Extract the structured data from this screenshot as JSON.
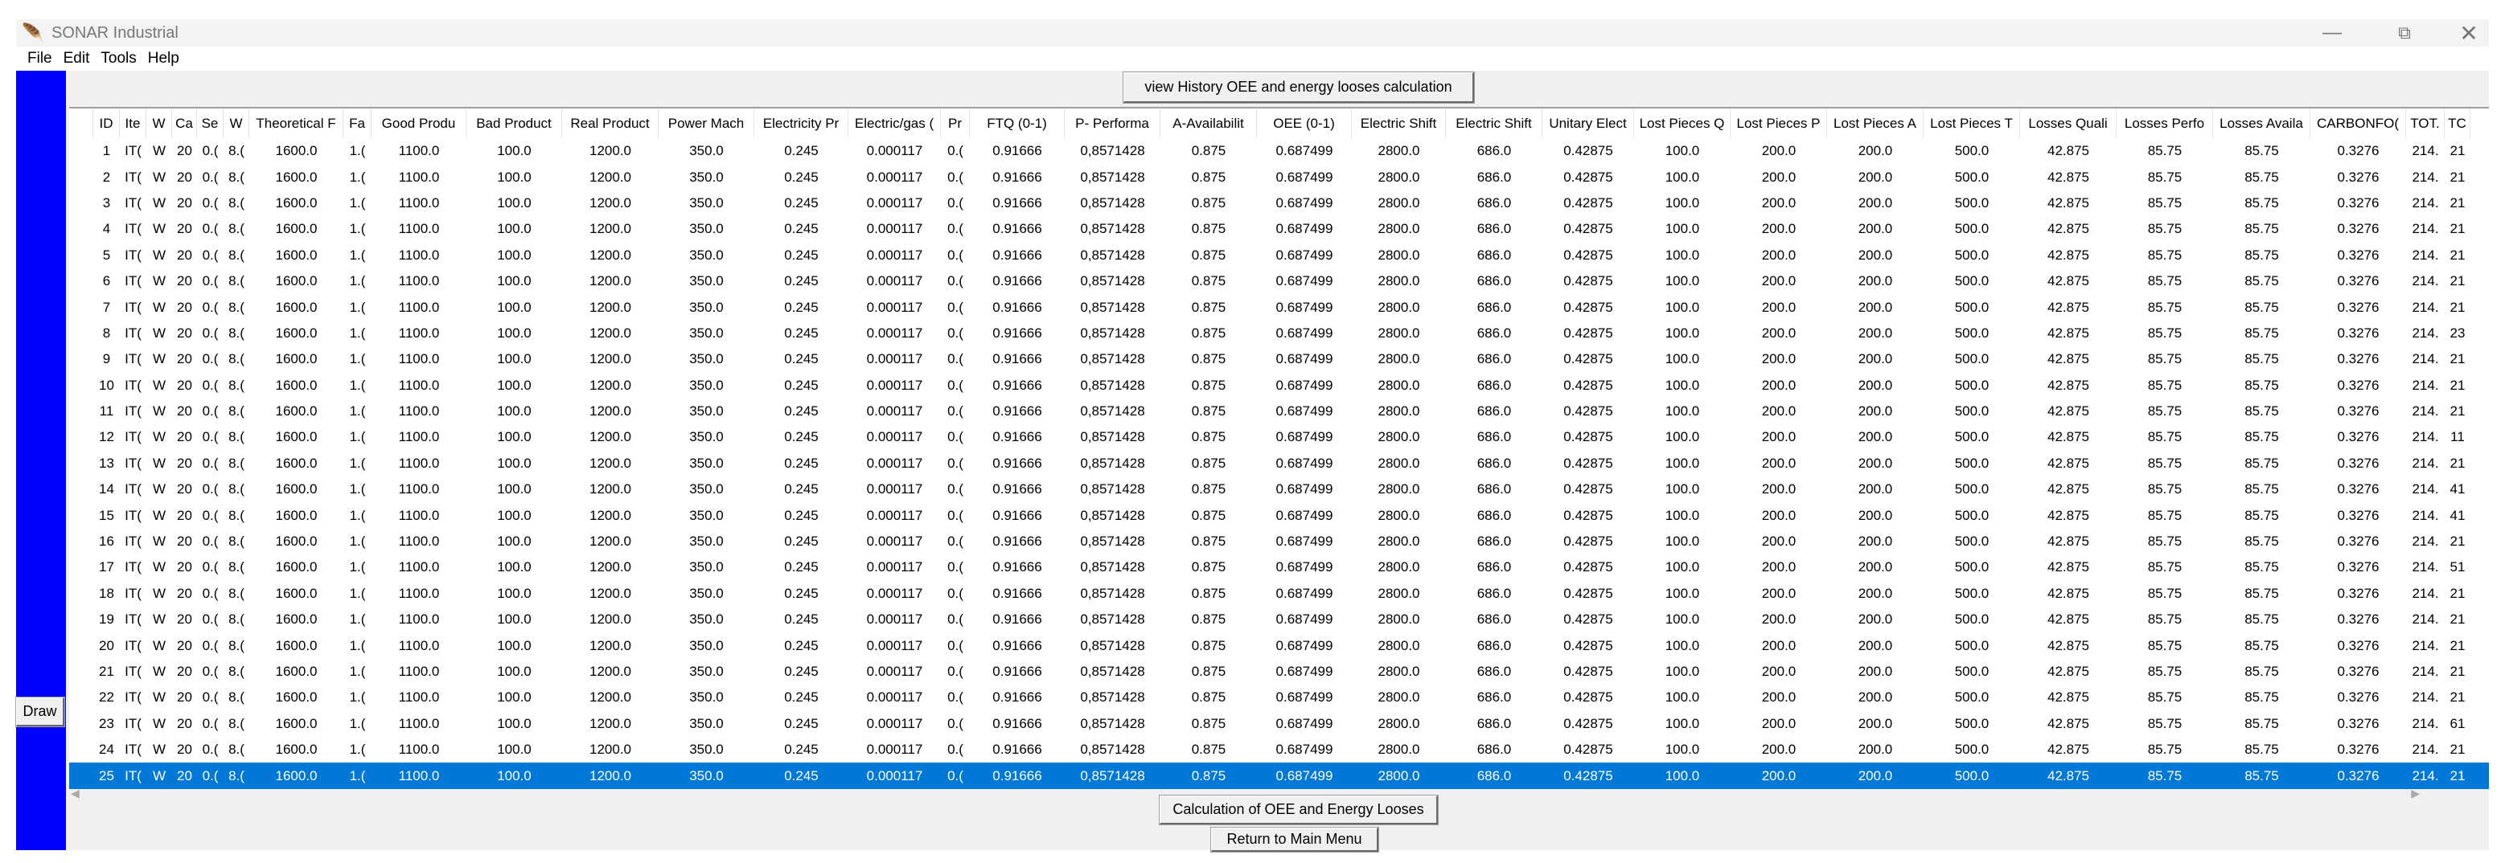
{
  "window": {
    "title": "SONAR Industrial",
    "icon": "feather-icon",
    "controls": [
      "minimize",
      "restore",
      "close"
    ]
  },
  "menu": [
    "File",
    "Edit",
    "Tools",
    "Help"
  ],
  "buttons": {
    "history": "view History OEE and energy looses calculation",
    "calc": "Calculation of OEE and Energy Looses",
    "return": "Return to Main Menu",
    "draw": "Draw"
  },
  "colors": {
    "sidebar": "#0000ff",
    "selection": "#0078d7"
  },
  "table": {
    "headers": [
      "",
      "ID",
      "Ite",
      "W",
      "Ca",
      "Se",
      "W",
      "Theoretical F",
      "Fa",
      "Good Produ",
      "Bad Product",
      "Real Product",
      "Power Mach",
      "Electricity Pr",
      "Electric/gas (",
      "Pr",
      "FTQ (0-1)",
      "P- Performa",
      "A-Availabilit",
      "OEE (0-1)",
      "Electric Shift",
      "Electric Shift",
      "Unitary Elect",
      "Lost Pieces Q",
      "Lost Pieces P",
      "Lost Pieces A",
      "Lost Pieces T",
      "Losses Quali",
      "Losses Perfo",
      "Losses Availa",
      "CARBONFO(",
      "TOT.",
      "TC"
    ],
    "selected_row": 25,
    "rows": [
      [
        "",
        "1",
        "IT(",
        "W",
        "20",
        "0.(",
        "8.(",
        "1600.0",
        "1.(",
        "1100.0",
        "100.0",
        "1200.0",
        "350.0",
        "0.245",
        "0.000117",
        "0.(",
        "0.91666",
        "0,8571428",
        "0.875",
        "0.687499",
        "2800.0",
        "686.0",
        "0.42875",
        "100.0",
        "200.0",
        "200.0",
        "500.0",
        "42.875",
        "85.75",
        "85.75",
        "0.3276",
        "214.",
        "21"
      ],
      [
        "",
        "2",
        "IT(",
        "W",
        "20",
        "0.(",
        "8.(",
        "1600.0",
        "1.(",
        "1100.0",
        "100.0",
        "1200.0",
        "350.0",
        "0.245",
        "0.000117",
        "0.(",
        "0.91666",
        "0,8571428",
        "0.875",
        "0.687499",
        "2800.0",
        "686.0",
        "0.42875",
        "100.0",
        "200.0",
        "200.0",
        "500.0",
        "42.875",
        "85.75",
        "85.75",
        "0.3276",
        "214.",
        "21"
      ],
      [
        "",
        "3",
        "IT(",
        "W",
        "20",
        "0.(",
        "8.(",
        "1600.0",
        "1.(",
        "1100.0",
        "100.0",
        "1200.0",
        "350.0",
        "0.245",
        "0.000117",
        "0.(",
        "0.91666",
        "0,8571428",
        "0.875",
        "0.687499",
        "2800.0",
        "686.0",
        "0.42875",
        "100.0",
        "200.0",
        "200.0",
        "500.0",
        "42.875",
        "85.75",
        "85.75",
        "0.3276",
        "214.",
        "21"
      ],
      [
        "",
        "4",
        "IT(",
        "W",
        "20",
        "0.(",
        "8.(",
        "1600.0",
        "1.(",
        "1100.0",
        "100.0",
        "1200.0",
        "350.0",
        "0.245",
        "0.000117",
        "0.(",
        "0.91666",
        "0,8571428",
        "0.875",
        "0.687499",
        "2800.0",
        "686.0",
        "0.42875",
        "100.0",
        "200.0",
        "200.0",
        "500.0",
        "42.875",
        "85.75",
        "85.75",
        "0.3276",
        "214.",
        "21"
      ],
      [
        "",
        "5",
        "IT(",
        "W",
        "20",
        "0.(",
        "8.(",
        "1600.0",
        "1.(",
        "1100.0",
        "100.0",
        "1200.0",
        "350.0",
        "0.245",
        "0.000117",
        "0.(",
        "0.91666",
        "0,8571428",
        "0.875",
        "0.687499",
        "2800.0",
        "686.0",
        "0.42875",
        "100.0",
        "200.0",
        "200.0",
        "500.0",
        "42.875",
        "85.75",
        "85.75",
        "0.3276",
        "214.",
        "21"
      ],
      [
        "",
        "6",
        "IT(",
        "W",
        "20",
        "0.(",
        "8.(",
        "1600.0",
        "1.(",
        "1100.0",
        "100.0",
        "1200.0",
        "350.0",
        "0.245",
        "0.000117",
        "0.(",
        "0.91666",
        "0,8571428",
        "0.875",
        "0.687499",
        "2800.0",
        "686.0",
        "0.42875",
        "100.0",
        "200.0",
        "200.0",
        "500.0",
        "42.875",
        "85.75",
        "85.75",
        "0.3276",
        "214.",
        "21"
      ],
      [
        "",
        "7",
        "IT(",
        "W",
        "20",
        "0.(",
        "8.(",
        "1600.0",
        "1.(",
        "1100.0",
        "100.0",
        "1200.0",
        "350.0",
        "0.245",
        "0.000117",
        "0.(",
        "0.91666",
        "0,8571428",
        "0.875",
        "0.687499",
        "2800.0",
        "686.0",
        "0.42875",
        "100.0",
        "200.0",
        "200.0",
        "500.0",
        "42.875",
        "85.75",
        "85.75",
        "0.3276",
        "214.",
        "21"
      ],
      [
        "",
        "8",
        "IT(",
        "W",
        "20",
        "0.(",
        "8.(",
        "1600.0",
        "1.(",
        "1100.0",
        "100.0",
        "1200.0",
        "350.0",
        "0.245",
        "0.000117",
        "0.(",
        "0.91666",
        "0,8571428",
        "0.875",
        "0.687499",
        "2800.0",
        "686.0",
        "0.42875",
        "100.0",
        "200.0",
        "200.0",
        "500.0",
        "42.875",
        "85.75",
        "85.75",
        "0.3276",
        "214.",
        "23"
      ],
      [
        "",
        "9",
        "IT(",
        "W",
        "20",
        "0.(",
        "8.(",
        "1600.0",
        "1.(",
        "1100.0",
        "100.0",
        "1200.0",
        "350.0",
        "0.245",
        "0.000117",
        "0.(",
        "0.91666",
        "0,8571428",
        "0.875",
        "0.687499",
        "2800.0",
        "686.0",
        "0.42875",
        "100.0",
        "200.0",
        "200.0",
        "500.0",
        "42.875",
        "85.75",
        "85.75",
        "0.3276",
        "214.",
        "21"
      ],
      [
        "",
        "10",
        "IT(",
        "W",
        "20",
        "0.(",
        "8.(",
        "1600.0",
        "1.(",
        "1100.0",
        "100.0",
        "1200.0",
        "350.0",
        "0.245",
        "0.000117",
        "0.(",
        "0.91666",
        "0,8571428",
        "0.875",
        "0.687499",
        "2800.0",
        "686.0",
        "0.42875",
        "100.0",
        "200.0",
        "200.0",
        "500.0",
        "42.875",
        "85.75",
        "85.75",
        "0.3276",
        "214.",
        "21"
      ],
      [
        "",
        "11",
        "IT(",
        "W",
        "20",
        "0.(",
        "8.(",
        "1600.0",
        "1.(",
        "1100.0",
        "100.0",
        "1200.0",
        "350.0",
        "0.245",
        "0.000117",
        "0.(",
        "0.91666",
        "0,8571428",
        "0.875",
        "0.687499",
        "2800.0",
        "686.0",
        "0.42875",
        "100.0",
        "200.0",
        "200.0",
        "500.0",
        "42.875",
        "85.75",
        "85.75",
        "0.3276",
        "214.",
        "21"
      ],
      [
        "",
        "12",
        "IT(",
        "W",
        "20",
        "0.(",
        "8.(",
        "1600.0",
        "1.(",
        "1100.0",
        "100.0",
        "1200.0",
        "350.0",
        "0.245",
        "0.000117",
        "0.(",
        "0.91666",
        "0,8571428",
        "0.875",
        "0.687499",
        "2800.0",
        "686.0",
        "0.42875",
        "100.0",
        "200.0",
        "200.0",
        "500.0",
        "42.875",
        "85.75",
        "85.75",
        "0.3276",
        "214.",
        "11"
      ],
      [
        "",
        "13",
        "IT(",
        "W",
        "20",
        "0.(",
        "8.(",
        "1600.0",
        "1.(",
        "1100.0",
        "100.0",
        "1200.0",
        "350.0",
        "0.245",
        "0.000117",
        "0.(",
        "0.91666",
        "0,8571428",
        "0.875",
        "0.687499",
        "2800.0",
        "686.0",
        "0.42875",
        "100.0",
        "200.0",
        "200.0",
        "500.0",
        "42.875",
        "85.75",
        "85.75",
        "0.3276",
        "214.",
        "21"
      ],
      [
        "",
        "14",
        "IT(",
        "W",
        "20",
        "0.(",
        "8.(",
        "1600.0",
        "1.(",
        "1100.0",
        "100.0",
        "1200.0",
        "350.0",
        "0.245",
        "0.000117",
        "0.(",
        "0.91666",
        "0,8571428",
        "0.875",
        "0.687499",
        "2800.0",
        "686.0",
        "0.42875",
        "100.0",
        "200.0",
        "200.0",
        "500.0",
        "42.875",
        "85.75",
        "85.75",
        "0.3276",
        "214.",
        "41"
      ],
      [
        "",
        "15",
        "IT(",
        "W",
        "20",
        "0.(",
        "8.(",
        "1600.0",
        "1.(",
        "1100.0",
        "100.0",
        "1200.0",
        "350.0",
        "0.245",
        "0.000117",
        "0.(",
        "0.91666",
        "0,8571428",
        "0.875",
        "0.687499",
        "2800.0",
        "686.0",
        "0.42875",
        "100.0",
        "200.0",
        "200.0",
        "500.0",
        "42.875",
        "85.75",
        "85.75",
        "0.3276",
        "214.",
        "41"
      ],
      [
        "",
        "16",
        "IT(",
        "W",
        "20",
        "0.(",
        "8.(",
        "1600.0",
        "1.(",
        "1100.0",
        "100.0",
        "1200.0",
        "350.0",
        "0.245",
        "0.000117",
        "0.(",
        "0.91666",
        "0,8571428",
        "0.875",
        "0.687499",
        "2800.0",
        "686.0",
        "0.42875",
        "100.0",
        "200.0",
        "200.0",
        "500.0",
        "42.875",
        "85.75",
        "85.75",
        "0.3276",
        "214.",
        "21"
      ],
      [
        "",
        "17",
        "IT(",
        "W",
        "20",
        "0.(",
        "8.(",
        "1600.0",
        "1.(",
        "1100.0",
        "100.0",
        "1200.0",
        "350.0",
        "0.245",
        "0.000117",
        "0.(",
        "0.91666",
        "0,8571428",
        "0.875",
        "0.687499",
        "2800.0",
        "686.0",
        "0.42875",
        "100.0",
        "200.0",
        "200.0",
        "500.0",
        "42.875",
        "85.75",
        "85.75",
        "0.3276",
        "214.",
        "51"
      ],
      [
        "",
        "18",
        "IT(",
        "W",
        "20",
        "0.(",
        "8.(",
        "1600.0",
        "1.(",
        "1100.0",
        "100.0",
        "1200.0",
        "350.0",
        "0.245",
        "0.000117",
        "0.(",
        "0.91666",
        "0,8571428",
        "0.875",
        "0.687499",
        "2800.0",
        "686.0",
        "0.42875",
        "100.0",
        "200.0",
        "200.0",
        "500.0",
        "42.875",
        "85.75",
        "85.75",
        "0.3276",
        "214.",
        "21"
      ],
      [
        "",
        "19",
        "IT(",
        "W",
        "20",
        "0.(",
        "8.(",
        "1600.0",
        "1.(",
        "1100.0",
        "100.0",
        "1200.0",
        "350.0",
        "0.245",
        "0.000117",
        "0.(",
        "0.91666",
        "0,8571428",
        "0.875",
        "0.687499",
        "2800.0",
        "686.0",
        "0.42875",
        "100.0",
        "200.0",
        "200.0",
        "500.0",
        "42.875",
        "85.75",
        "85.75",
        "0.3276",
        "214.",
        "21"
      ],
      [
        "",
        "20",
        "IT(",
        "W",
        "20",
        "0.(",
        "8.(",
        "1600.0",
        "1.(",
        "1100.0",
        "100.0",
        "1200.0",
        "350.0",
        "0.245",
        "0.000117",
        "0.(",
        "0.91666",
        "0,8571428",
        "0.875",
        "0.687499",
        "2800.0",
        "686.0",
        "0.42875",
        "100.0",
        "200.0",
        "200.0",
        "500.0",
        "42.875",
        "85.75",
        "85.75",
        "0.3276",
        "214.",
        "21"
      ],
      [
        "",
        "21",
        "IT(",
        "W",
        "20",
        "0.(",
        "8.(",
        "1600.0",
        "1.(",
        "1100.0",
        "100.0",
        "1200.0",
        "350.0",
        "0.245",
        "0.000117",
        "0.(",
        "0.91666",
        "0,8571428",
        "0.875",
        "0.687499",
        "2800.0",
        "686.0",
        "0.42875",
        "100.0",
        "200.0",
        "200.0",
        "500.0",
        "42.875",
        "85.75",
        "85.75",
        "0.3276",
        "214.",
        "21"
      ],
      [
        "",
        "22",
        "IT(",
        "W",
        "20",
        "0.(",
        "8.(",
        "1600.0",
        "1.(",
        "1100.0",
        "100.0",
        "1200.0",
        "350.0",
        "0.245",
        "0.000117",
        "0.(",
        "0.91666",
        "0,8571428",
        "0.875",
        "0.687499",
        "2800.0",
        "686.0",
        "0.42875",
        "100.0",
        "200.0",
        "200.0",
        "500.0",
        "42.875",
        "85.75",
        "85.75",
        "0.3276",
        "214.",
        "21"
      ],
      [
        "",
        "23",
        "IT(",
        "W",
        "20",
        "0.(",
        "8.(",
        "1600.0",
        "1.(",
        "1100.0",
        "100.0",
        "1200.0",
        "350.0",
        "0.245",
        "0.000117",
        "0.(",
        "0.91666",
        "0,8571428",
        "0.875",
        "0.687499",
        "2800.0",
        "686.0",
        "0.42875",
        "100.0",
        "200.0",
        "200.0",
        "500.0",
        "42.875",
        "85.75",
        "85.75",
        "0.3276",
        "214.",
        "61"
      ],
      [
        "",
        "24",
        "IT(",
        "W",
        "20",
        "0.(",
        "8.(",
        "1600.0",
        "1.(",
        "1100.0",
        "100.0",
        "1200.0",
        "350.0",
        "0.245",
        "0.000117",
        "0.(",
        "0.91666",
        "0,8571428",
        "0.875",
        "0.687499",
        "2800.0",
        "686.0",
        "0.42875",
        "100.0",
        "200.0",
        "200.0",
        "500.0",
        "42.875",
        "85.75",
        "85.75",
        "0.3276",
        "214.",
        "21"
      ],
      [
        "",
        "25",
        "IT(",
        "W",
        "20",
        "0.(",
        "8.(",
        "1600.0",
        "1.(",
        "1100.0",
        "100.0",
        "1200.0",
        "350.0",
        "0.245",
        "0.000117",
        "0.(",
        "0.91666",
        "0,8571428",
        "0.875",
        "0.687499",
        "2800.0",
        "686.0",
        "0.42875",
        "100.0",
        "200.0",
        "200.0",
        "500.0",
        "42.875",
        "85.75",
        "85.75",
        "0.3276",
        "214.",
        "21"
      ]
    ]
  }
}
